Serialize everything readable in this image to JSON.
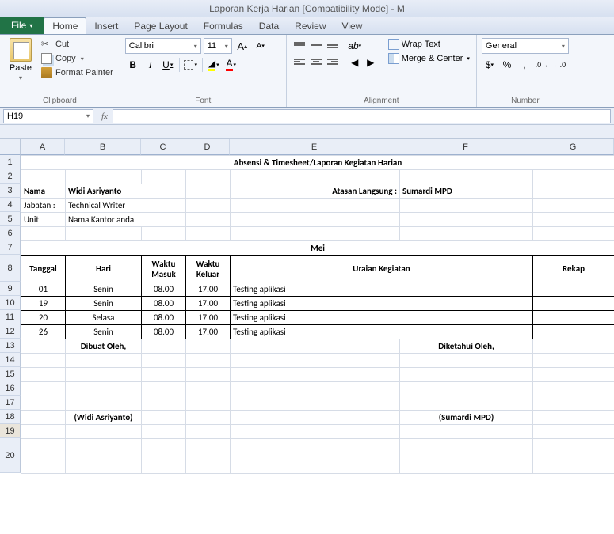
{
  "window": {
    "title": "Laporan Kerja Harian  [Compatibility Mode]  -  M"
  },
  "tabs": {
    "file": "File",
    "items": [
      "Home",
      "Insert",
      "Page Layout",
      "Formulas",
      "Data",
      "Review",
      "View"
    ],
    "active": "Home"
  },
  "ribbon": {
    "clipboard": {
      "paste": "Paste",
      "cut": "Cut",
      "copy": "Copy",
      "format_painter": "Format Painter",
      "label": "Clipboard"
    },
    "font": {
      "name": "Calibri",
      "size": "11",
      "grow": "A",
      "shrink": "A",
      "label": "Font"
    },
    "alignment": {
      "wrap": "Wrap Text",
      "merge": "Merge & Center",
      "label": "Alignment"
    },
    "number": {
      "format": "General",
      "label": "Number"
    }
  },
  "namebox": "H19",
  "formula": "",
  "columns": [
    "A",
    "B",
    "C",
    "D",
    "E",
    "F",
    "G"
  ],
  "rows": [
    1,
    2,
    3,
    4,
    5,
    6,
    7,
    8,
    9,
    10,
    11,
    12,
    13,
    14,
    15,
    16,
    17,
    18,
    19,
    20
  ],
  "sheet": {
    "title": "Absensi & Timesheet/Laporan Kegiatan Harian",
    "labels": {
      "nama": "Nama",
      "jabatan": "Jabatan :",
      "unit": "Unit",
      "atasan": "Atasan Langsung :"
    },
    "values": {
      "nama": "Widi Asriyanto",
      "jabatan": "Technical Writer",
      "unit": "Nama Kantor anda",
      "atasan": "Sumardi MPD"
    },
    "month": "Mei",
    "headers": {
      "tanggal": "Tanggal",
      "hari": "Hari",
      "waktu_masuk": "Waktu Masuk",
      "waktu_keluar": "Waktu Keluar",
      "uraian": "Uraian Kegiatan",
      "rekap": "Rekap"
    },
    "rows": [
      {
        "tgl": "01",
        "hari": "Senin",
        "masuk": "08.00",
        "keluar": "17.00",
        "uraian": "Testing aplikasi"
      },
      {
        "tgl": "19",
        "hari": "Senin",
        "masuk": "08.00",
        "keluar": "17.00",
        "uraian": "Testing aplikasi"
      },
      {
        "tgl": "20",
        "hari": "Selasa",
        "masuk": "08.00",
        "keluar": "17.00",
        "uraian": "Testing aplikasi"
      },
      {
        "tgl": "26",
        "hari": "Senin",
        "masuk": "08.00",
        "keluar": "17.00",
        "uraian": "Testing aplikasi"
      }
    ],
    "dibuat": "Dibuat Oleh,",
    "diketahui": "Diketahui Oleh,",
    "sig1": "(Widi Asriyanto)",
    "sig2": "(Sumardi MPD)"
  }
}
